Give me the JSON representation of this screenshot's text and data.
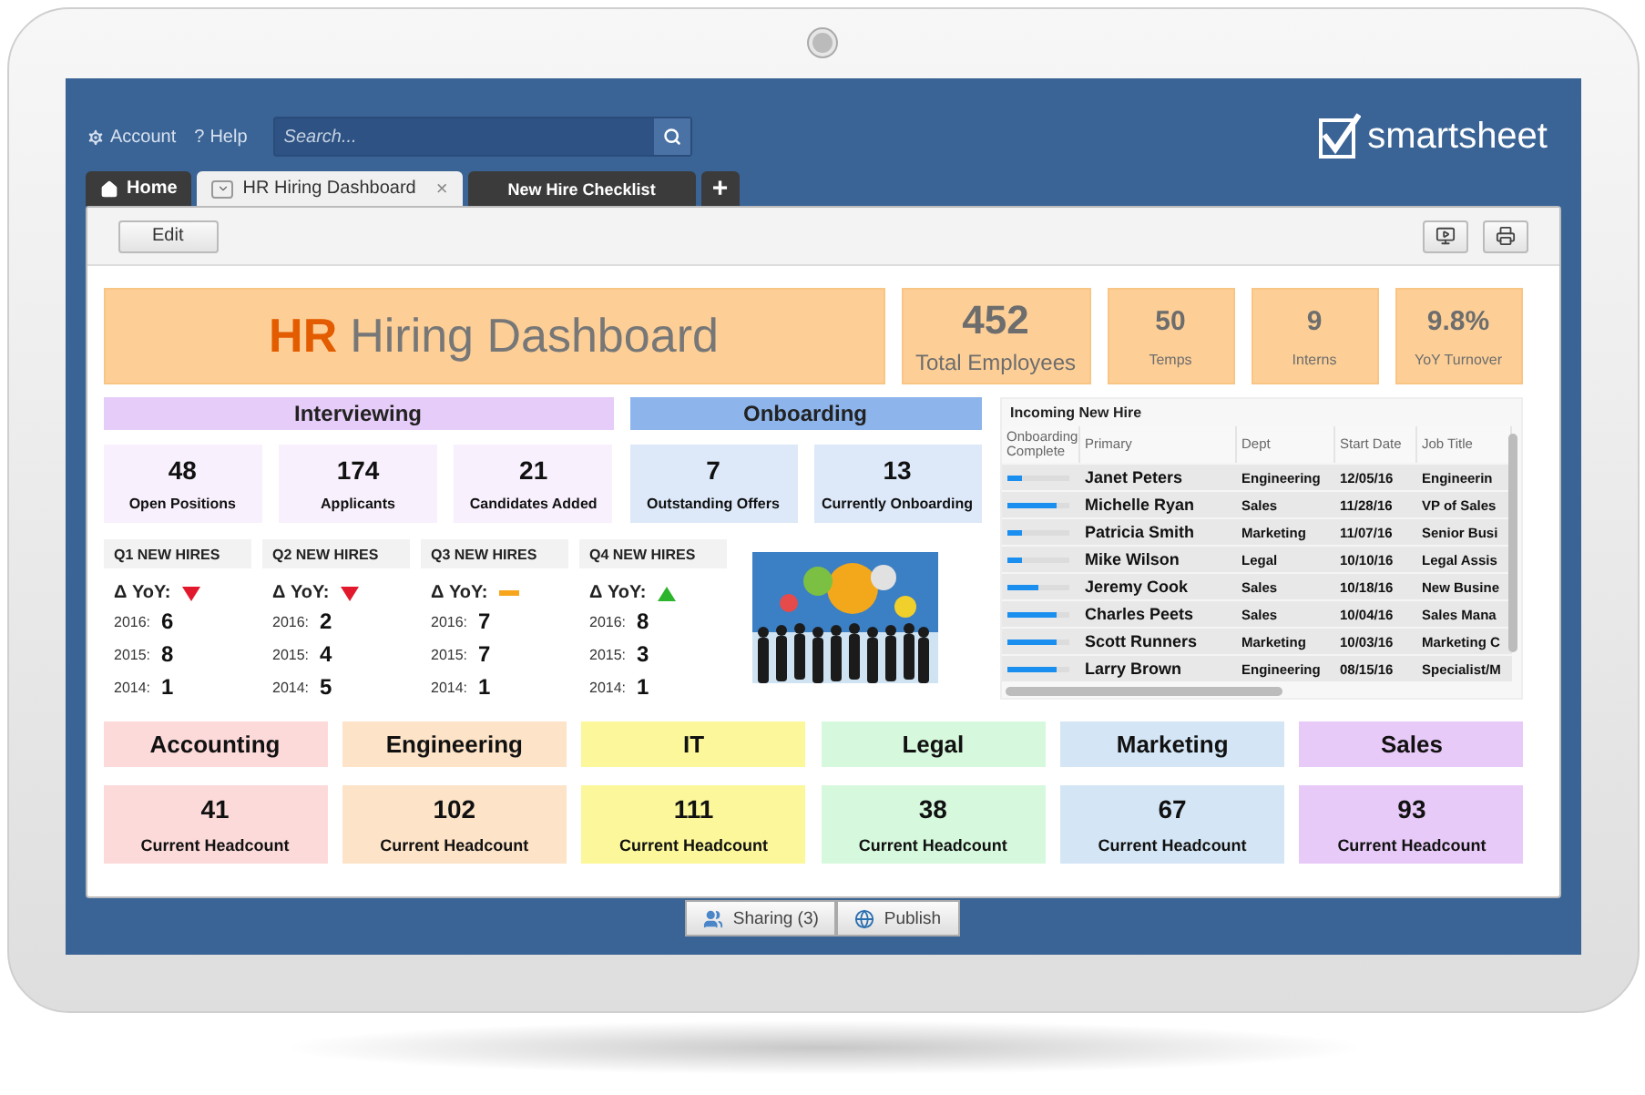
{
  "topbar": {
    "account": "Account",
    "help_mark": "?",
    "help": "Help",
    "search": {
      "placeholder": "Search..."
    },
    "logo": "smartsheet"
  },
  "tabs": [
    {
      "kind": "home",
      "label": "Home",
      "selected": false
    },
    {
      "kind": "sheet",
      "label": "HR Hiring Dashboard",
      "close": "×",
      "selected": true
    },
    {
      "kind": "sheet",
      "label": "New Hire Checklist",
      "selected": false
    },
    {
      "kind": "add",
      "label": "+",
      "selected": false
    }
  ],
  "toolbar": {
    "edit": "Edit"
  },
  "title": {
    "accent": "HR",
    "rest": "Hiring Dashboard"
  },
  "stats": [
    {
      "value": "452",
      "label": "Total Employees",
      "kind": "large"
    },
    {
      "value": "50",
      "label": "Temps",
      "kind": "small"
    },
    {
      "value": "9",
      "label": "Interns",
      "kind": "small"
    },
    {
      "value": "9.8%",
      "label": "YoY Turnover",
      "kind": "small"
    }
  ],
  "sections": [
    {
      "title": "Interviewing",
      "color": "#e6ccf8",
      "cards": [
        {
          "value": "48",
          "label": "Open Positions"
        },
        {
          "value": "174",
          "label": "Applicants"
        },
        {
          "value": "21",
          "label": "Candidates Added"
        }
      ]
    },
    {
      "title": "Onboarding",
      "color": "#8db5ec",
      "cards": [
        {
          "value": "7",
          "label": "Outstanding Offers"
        },
        {
          "value": "13",
          "label": "Currently Onboarding"
        }
      ]
    }
  ],
  "quarters": [
    {
      "title": "Q1 NEW HIRES",
      "delta": "Δ YoY:",
      "kind": "down",
      "years": [
        {
          "year": "2016:",
          "count": "6"
        },
        {
          "year": "2015:",
          "count": "8"
        },
        {
          "year": "2014:",
          "count": "1"
        }
      ]
    },
    {
      "title": "Q2 NEW HIRES",
      "delta": "Δ YoY:",
      "kind": "down",
      "years": [
        {
          "year": "2016:",
          "count": "2"
        },
        {
          "year": "2015:",
          "count": "4"
        },
        {
          "year": "2014:",
          "count": "5"
        }
      ]
    },
    {
      "title": "Q3 NEW HIRES",
      "delta": "Δ YoY:",
      "kind": "flat",
      "years": [
        {
          "year": "2016:",
          "count": "7"
        },
        {
          "year": "2015:",
          "count": "7"
        },
        {
          "year": "2014:",
          "count": "1"
        }
      ]
    },
    {
      "title": "Q4 NEW HIRES",
      "delta": "Δ YoY:",
      "kind": "up",
      "years": [
        {
          "year": "2016:",
          "count": "8"
        },
        {
          "year": "2015:",
          "count": "3"
        },
        {
          "year": "2014:",
          "count": "1"
        }
      ]
    }
  ],
  "table": {
    "title": "Incoming New Hire",
    "columns": [
      "Onboarding Complete",
      "Primary",
      "Dept",
      "Start Date",
      "Job Title"
    ],
    "rows": [
      {
        "level": 0.25,
        "name": "Janet Peters",
        "dept": "Engineering",
        "start": "12/05/16",
        "job": "Engineerin"
      },
      {
        "level": 0.8,
        "name": "Michelle Ryan",
        "dept": "Sales",
        "start": "11/28/16",
        "job": "VP of Sales"
      },
      {
        "level": 0.25,
        "name": "Patricia Smith",
        "dept": "Marketing",
        "start": "11/07/16",
        "job": "Senior Busi"
      },
      {
        "level": 0.25,
        "name": "Mike Wilson",
        "dept": "Legal",
        "start": "10/10/16",
        "job": "Legal Assis"
      },
      {
        "level": 0.5,
        "name": "Jeremy Cook",
        "dept": "Sales",
        "start": "10/18/16",
        "job": "New Busine"
      },
      {
        "level": 0.8,
        "name": "Charles Peets",
        "dept": "Sales",
        "start": "10/04/16",
        "job": "Sales Mana"
      },
      {
        "level": 0.8,
        "name": "Scott Runners",
        "dept": "Marketing",
        "start": "10/03/16",
        "job": "Marketing C"
      },
      {
        "level": 0.8,
        "name": "Larry Brown",
        "dept": "Engineering",
        "start": "08/15/16",
        "job": "Specialist/M"
      }
    ]
  },
  "departments": [
    {
      "name": "Accounting",
      "count": "41",
      "label": "Current Headcount",
      "color": "#fddada"
    },
    {
      "name": "Engineering",
      "count": "102",
      "label": "Current Headcount",
      "color": "#fde3c7"
    },
    {
      "name": "IT",
      "count": "111",
      "label": "Current Headcount",
      "color": "#fbf79a"
    },
    {
      "name": "Legal",
      "count": "38",
      "label": "Current Headcount",
      "color": "#d6f9dd"
    },
    {
      "name": "Marketing",
      "count": "67",
      "label": "Current Headcount",
      "color": "#d4e6f5"
    },
    {
      "name": "Sales",
      "count": "93",
      "label": "Current Headcount",
      "color": "#e8caf8"
    }
  ],
  "bottom": {
    "sharing": "Sharing (3)",
    "publish": "Publish"
  }
}
